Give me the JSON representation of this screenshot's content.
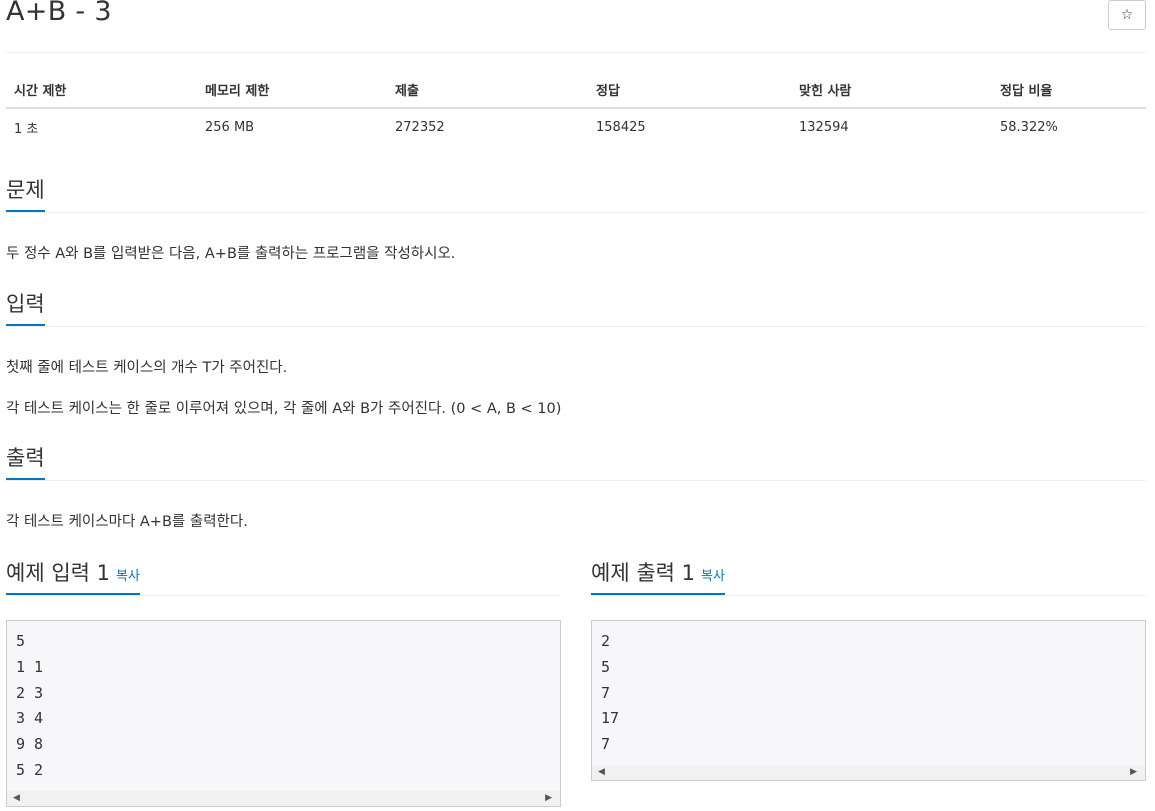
{
  "problem": {
    "title": "A+B - 3",
    "star_icon": "☆"
  },
  "info_table": {
    "headers": [
      "시간 제한",
      "메모리 제한",
      "제출",
      "정답",
      "맞힌 사람",
      "정답 비율"
    ],
    "values": [
      "1 초",
      "256 MB",
      "272352",
      "158425",
      "132594",
      "58.322%"
    ]
  },
  "sections": {
    "problem": {
      "heading": "문제",
      "text": "두 정수 A와 B를 입력받은 다음, A+B를 출력하는 프로그램을 작성하시오."
    },
    "input": {
      "heading": "입력",
      "lines": [
        "첫째 줄에 테스트 케이스의 개수 T가 주어진다.",
        "각 테스트 케이스는 한 줄로 이루어져 있으며, 각 줄에 A와 B가 주어진다. (0 < A, B < 10)"
      ]
    },
    "output": {
      "heading": "출력",
      "text": "각 테스트 케이스마다 A+B를 출력한다."
    }
  },
  "samples": {
    "input": {
      "heading": "예제 입력 1",
      "copy_label": "복사",
      "content": "5\n1 1\n2 3\n3 4\n9 8\n5 2"
    },
    "output": {
      "heading": "예제 출력 1",
      "copy_label": "복사",
      "content": "2\n5\n7\n17\n7"
    }
  },
  "colors": {
    "accent": "#0076c0",
    "text": "#333333",
    "sample_bg": "#f7f7f9"
  }
}
